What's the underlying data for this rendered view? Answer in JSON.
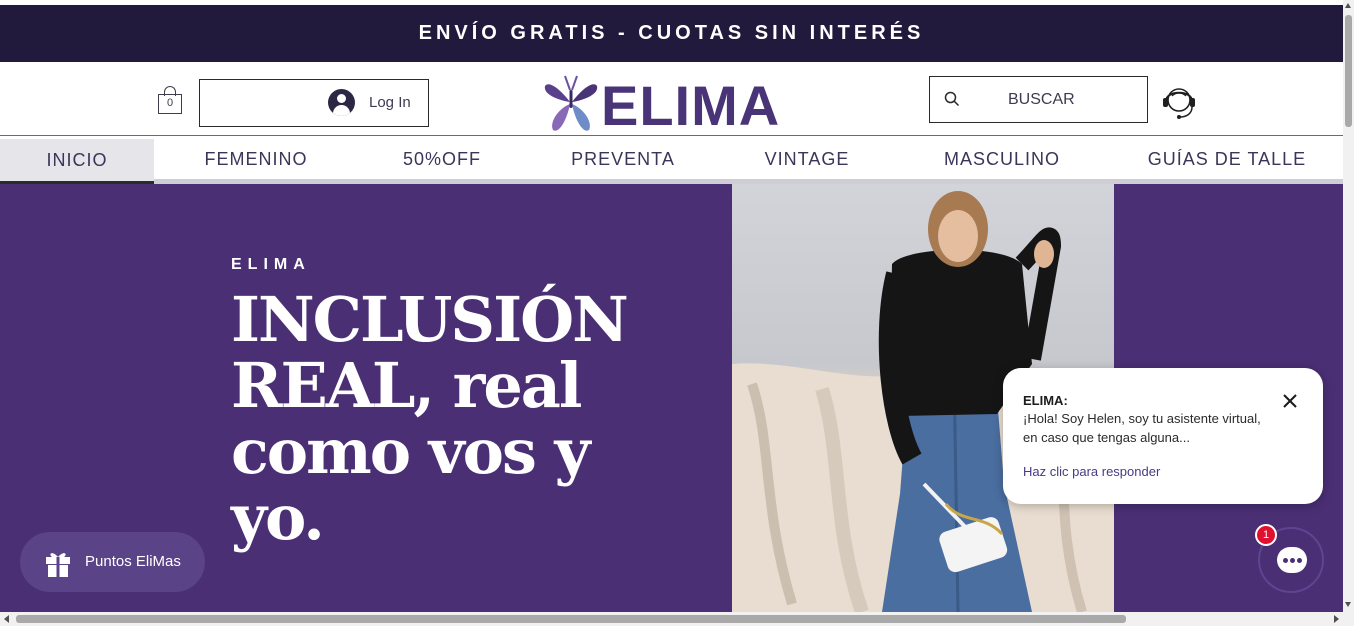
{
  "banner": {
    "text": "ENVÍO GRATIS - CUOTAS SIN INTERÉS"
  },
  "header": {
    "cart_count": "0",
    "login_label": "Log In",
    "logo_text": "ELIMA",
    "search_label": "BUSCAR",
    "icons": {
      "cart": "shopping-bag-icon",
      "login": "user-avatar-icon",
      "search": "search-icon",
      "support": "headset-support-icon"
    }
  },
  "nav": {
    "items": [
      {
        "label": "INICIO",
        "active": true
      },
      {
        "label": "FEMENINO"
      },
      {
        "label": "50%OFF"
      },
      {
        "label": "PREVENTA"
      },
      {
        "label": "VINTAGE"
      },
      {
        "label": "MASCULINO"
      },
      {
        "label": "GUÍAS DE TALLE"
      }
    ]
  },
  "hero": {
    "kicker": "ELIMA",
    "title": "INCLUSIÓN REAL, real como vos y yo."
  },
  "chat": {
    "from": "ELIMA:",
    "message": "¡Hola! Soy Helen, soy tu asistente virtual, en caso que tengas alguna...",
    "reply_label": "Haz clic para responder",
    "badge_count": "1"
  },
  "rewards": {
    "label": "Puntos EliMas"
  },
  "colors": {
    "banner_bg": "#221a3c",
    "brand_purple": "#4a3478",
    "hero_bg": "#4a2f74",
    "badge_red": "#e0102e"
  }
}
